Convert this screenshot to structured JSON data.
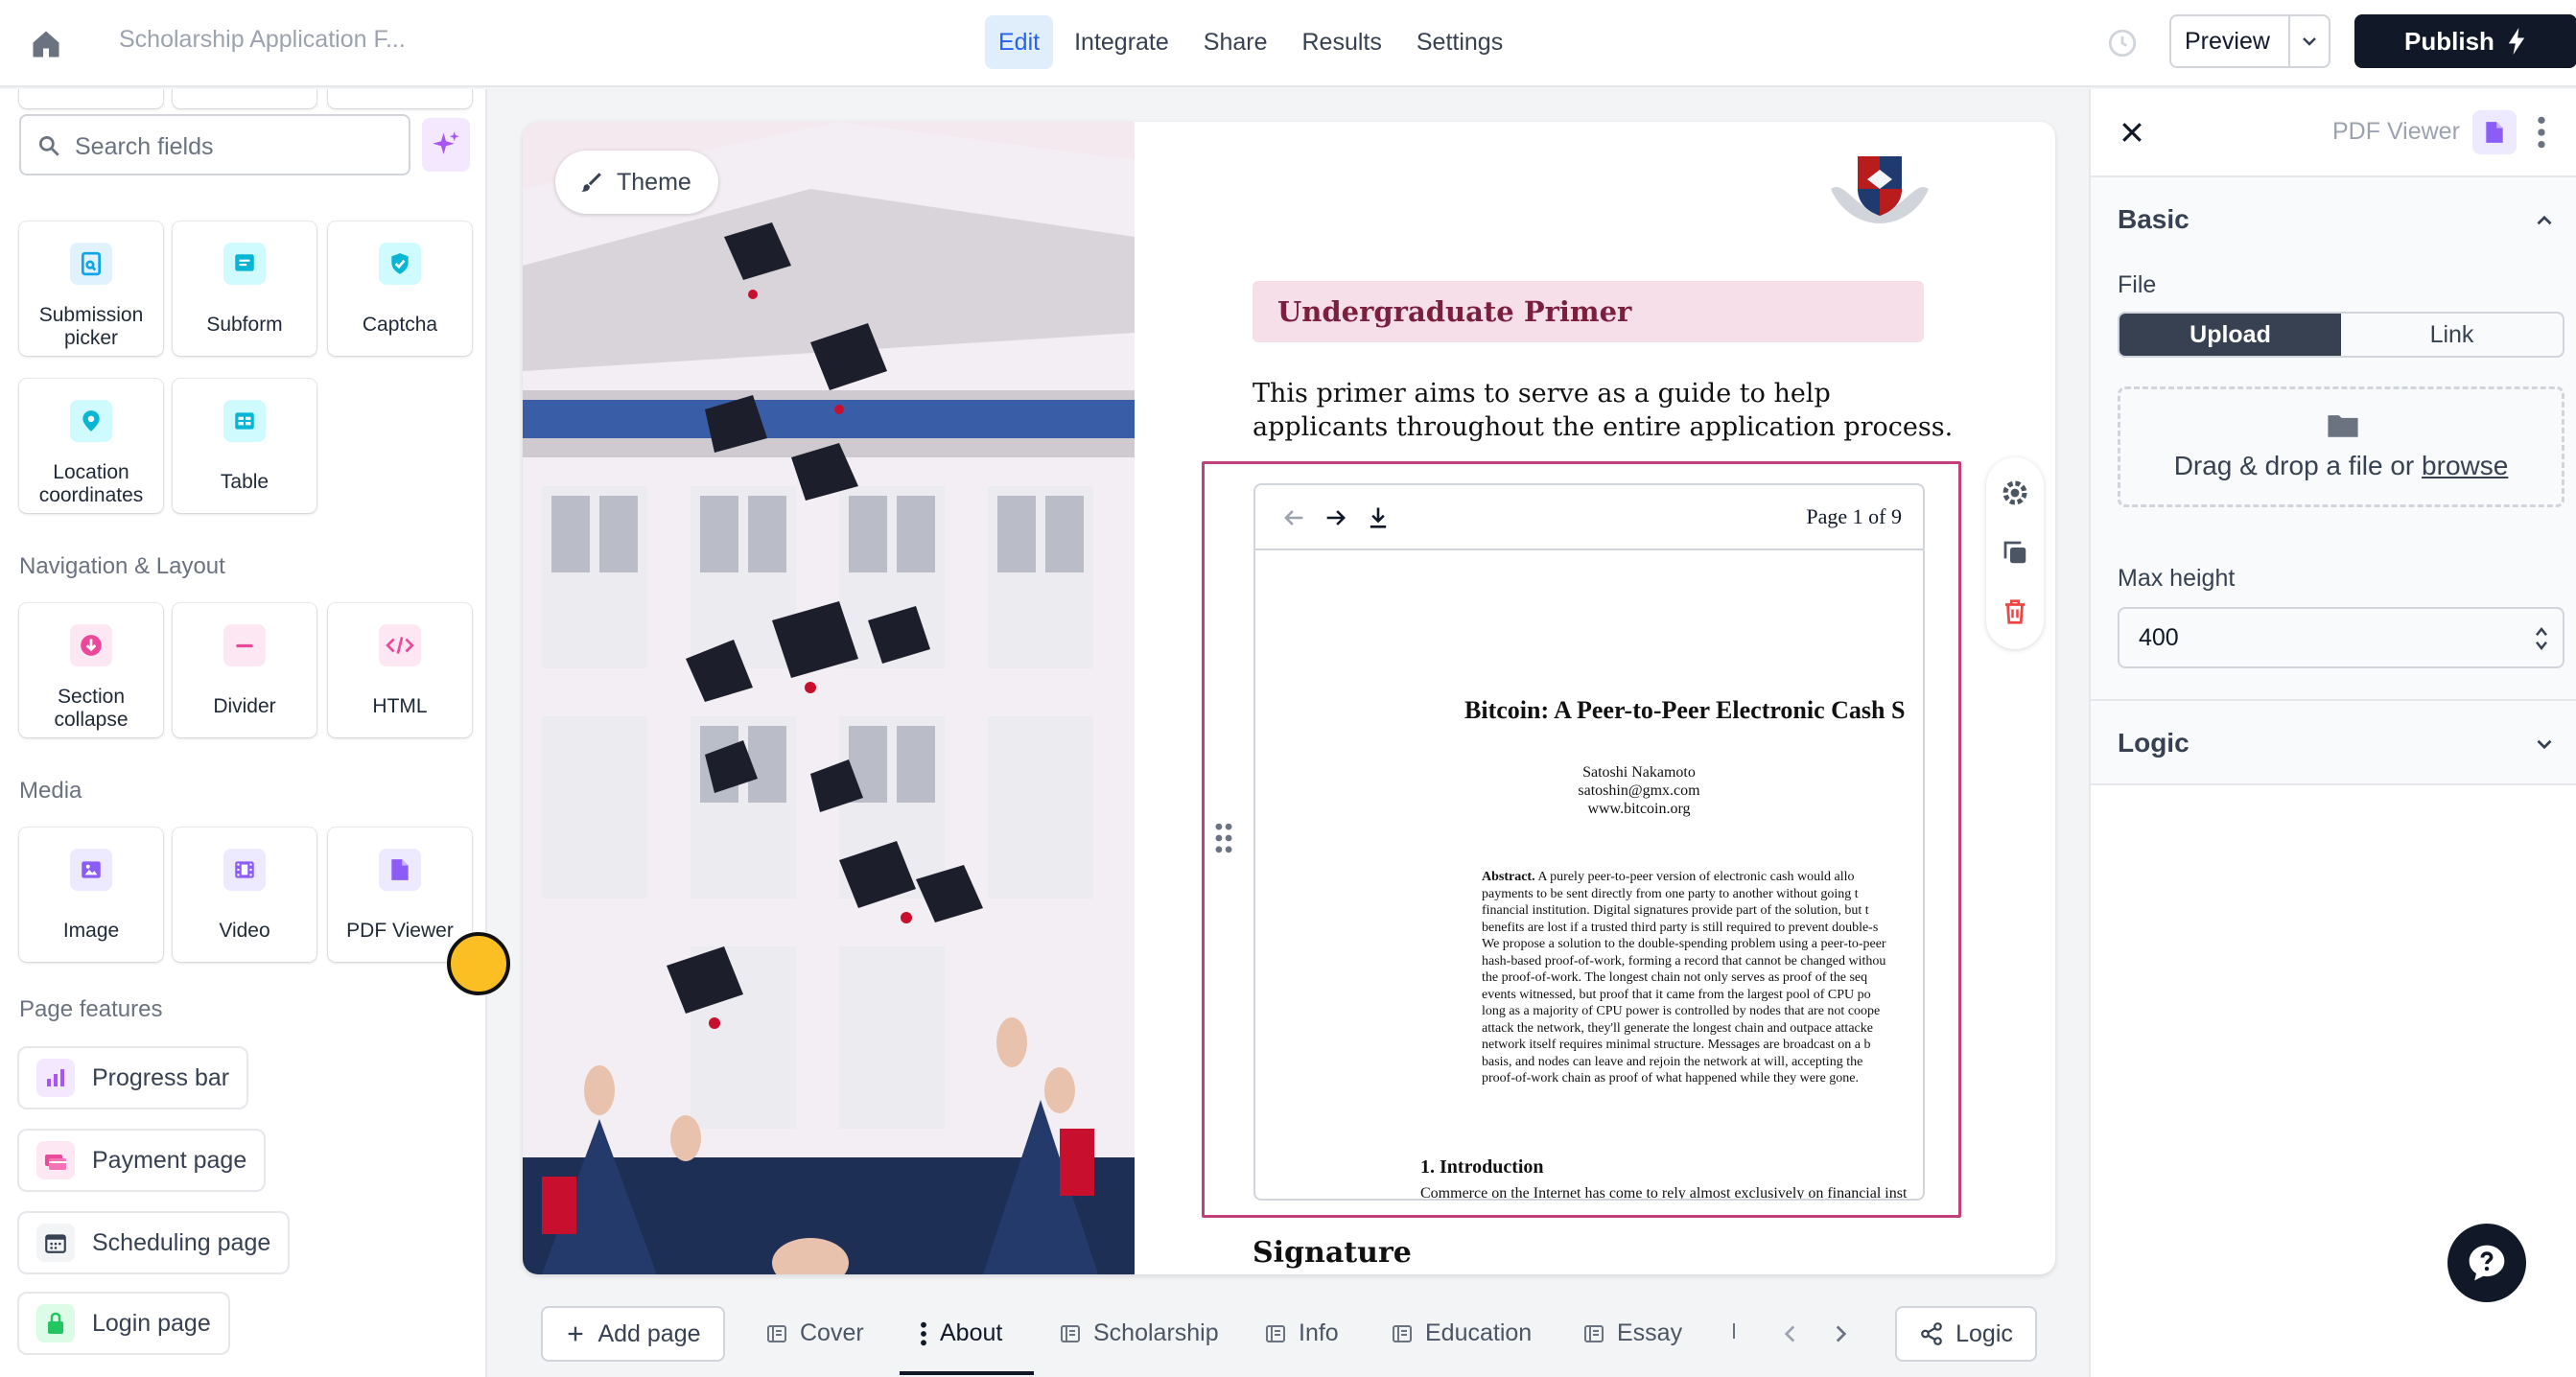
{
  "header": {
    "form_title": "Scholarship Application F...",
    "nav": [
      "Edit",
      "Integrate",
      "Share",
      "Results",
      "Settings"
    ],
    "active_nav": "Edit",
    "preview_label": "Preview",
    "publish_label": "Publish"
  },
  "sidebar": {
    "search_placeholder": "Search fields",
    "fields_top": [
      {
        "label": "Submission picker",
        "icon": "submission-picker-icon",
        "color": "#0ea5e9"
      },
      {
        "label": "Subform",
        "icon": "subform-icon",
        "color": "#06b6d4"
      },
      {
        "label": "Captcha",
        "icon": "captcha-shield-icon",
        "color": "#06b6d4"
      },
      {
        "label": "Location coordinates",
        "icon": "location-pin-icon",
        "color": "#06b6d4"
      },
      {
        "label": "Table",
        "icon": "table-icon",
        "color": "#06b6d4"
      }
    ],
    "nav_layout_title": "Navigation & Layout",
    "nav_layout": [
      {
        "label": "Section collapse",
        "icon": "section-collapse-icon",
        "color": "#ec4899"
      },
      {
        "label": "Divider",
        "icon": "divider-icon",
        "color": "#ec4899"
      },
      {
        "label": "HTML",
        "icon": "html-code-icon",
        "color": "#ec4899"
      }
    ],
    "media_title": "Media",
    "media": [
      {
        "label": "Image",
        "icon": "image-icon",
        "color": "#8b5cf6"
      },
      {
        "label": "Video",
        "icon": "video-icon",
        "color": "#8b5cf6"
      },
      {
        "label": "PDF Viewer",
        "icon": "pdf-icon",
        "color": "#8b5cf6"
      }
    ],
    "page_features_title": "Page features",
    "page_features": [
      {
        "label": "Progress bar",
        "icon": "progress-bar-icon"
      },
      {
        "label": "Payment page",
        "icon": "payment-icon"
      },
      {
        "label": "Scheduling page",
        "icon": "calendar-icon"
      },
      {
        "label": "Login page",
        "icon": "lock-icon"
      }
    ]
  },
  "canvas": {
    "theme_label": "Theme",
    "primer_title": "Undergraduate Primer",
    "primer_text": "This primer aims to serve as a guide to help applicants throughout the entire application process.",
    "pdf": {
      "page_info": "Page 1 of 9",
      "doc_title": "Bitcoin: A Peer-to-Peer Electronic Cash S",
      "author_lines": [
        "Satoshi Nakamoto",
        "satoshin@gmx.com",
        "www.bitcoin.org"
      ],
      "abstract_label": "Abstract.",
      "abstract_lines": [
        "A purely peer-to-peer version of electronic cash would allo",
        "payments to be sent directly from one party to another without going t",
        "financial institution.  Digital signatures provide part of the solution, but t",
        "benefits are lost if a trusted third party is still required to prevent double-s",
        "We propose a solution to the double-spending problem using a peer-to-peer",
        "hash-based proof-of-work, forming a record that cannot be changed withou",
        "the proof-of-work.  The longest chain not only serves as proof of the seq",
        "events witnessed, but proof that it came from the largest pool of CPU po",
        "long as a majority of CPU power is controlled by nodes that are not coope",
        "attack the network, they'll generate the longest chain and outpace attacke",
        "network itself requires minimal structure.  Messages are broadcast on a b",
        "basis, and nodes can leave and rejoin the network at will, accepting the",
        "proof-of-work chain as proof of what happened while they were gone."
      ],
      "intro_heading": "1.    Introduction",
      "intro_text": "Commerce on the Internet has come to rely almost exclusively on financial inst"
    },
    "signature_heading": "Signature"
  },
  "pagebar": {
    "add_page": "Add page",
    "tabs": [
      "Cover",
      "About",
      "Scholarship",
      "Info",
      "Education",
      "Essay"
    ],
    "active_tab": "About",
    "logic_label": "Logic"
  },
  "right_panel": {
    "title": "PDF Viewer",
    "basic_title": "Basic",
    "file_label": "File",
    "upload_label": "Upload",
    "link_label": "Link",
    "drop_text": "Drag & drop a file or",
    "browse_text": "browse",
    "max_height_label": "Max height",
    "max_height_value": "400",
    "logic_title": "Logic"
  },
  "colors": {
    "accent": "#2563eb",
    "selection": "#c2407a",
    "primer_bg": "#f6dfe9",
    "publish_bg": "#111827"
  }
}
